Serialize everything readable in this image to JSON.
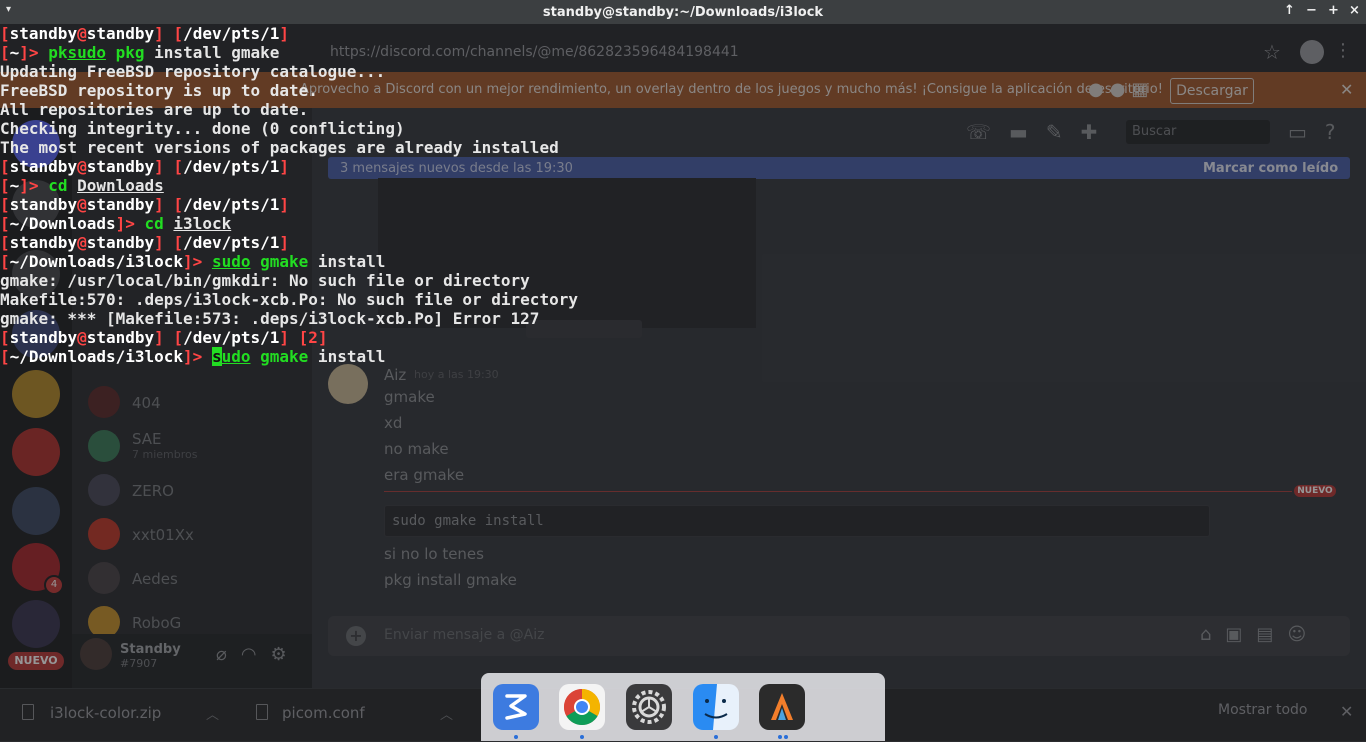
{
  "window": {
    "title": "standby@standby:~/Downloads/i3lock",
    "menu_icon": "▾",
    "controls": [
      "↑",
      "−",
      "+",
      "×"
    ]
  },
  "terminal": {
    "lines": [
      [
        {
          "t": "[",
          "c": "red"
        },
        {
          "t": "standby",
          "c": "white"
        },
        {
          "t": "@",
          "c": "red"
        },
        {
          "t": "standby",
          "c": "white"
        },
        {
          "t": "] [",
          "c": "red"
        },
        {
          "t": "/dev/pts/1",
          "c": "white"
        },
        {
          "t": "]",
          "c": "red"
        }
      ],
      [
        {
          "t": "[",
          "c": "red"
        },
        {
          "t": "~",
          "c": "white"
        },
        {
          "t": "]> ",
          "c": "red"
        },
        {
          "t": "pk",
          "c": "green"
        },
        {
          "t": "sudo",
          "c": "green ul"
        },
        {
          "t": " ",
          "c": ""
        },
        {
          "t": "pkg",
          "c": "green"
        },
        {
          "t": " install gmake",
          "c": ""
        }
      ],
      [
        {
          "t": "Updating FreeBSD repository catalogue...",
          "c": ""
        }
      ],
      [
        {
          "t": "FreeBSD repository is up to date.",
          "c": ""
        }
      ],
      [
        {
          "t": "All repositories are up to date.",
          "c": ""
        }
      ],
      [
        {
          "t": "Checking integrity... done (0 conflicting)",
          "c": ""
        }
      ],
      [
        {
          "t": "The most recent versions of packages are already installed",
          "c": ""
        }
      ],
      [
        {
          "t": "[",
          "c": "red"
        },
        {
          "t": "standby",
          "c": "white"
        },
        {
          "t": "@",
          "c": "red"
        },
        {
          "t": "standby",
          "c": "white"
        },
        {
          "t": "] [",
          "c": "red"
        },
        {
          "t": "/dev/pts/1",
          "c": "white"
        },
        {
          "t": "]",
          "c": "red"
        }
      ],
      [
        {
          "t": "[",
          "c": "red"
        },
        {
          "t": "~",
          "c": "white"
        },
        {
          "t": "]> ",
          "c": "red"
        },
        {
          "t": "cd",
          "c": "green"
        },
        {
          "t": " ",
          "c": ""
        },
        {
          "t": "Downloads",
          "c": "ul"
        }
      ],
      [
        {
          "t": "[",
          "c": "red"
        },
        {
          "t": "standby",
          "c": "white"
        },
        {
          "t": "@",
          "c": "red"
        },
        {
          "t": "standby",
          "c": "white"
        },
        {
          "t": "] [",
          "c": "red"
        },
        {
          "t": "/dev/pts/1",
          "c": "white"
        },
        {
          "t": "]",
          "c": "red"
        }
      ],
      [
        {
          "t": "[",
          "c": "red"
        },
        {
          "t": "~/Downloads",
          "c": "white"
        },
        {
          "t": "]> ",
          "c": "red"
        },
        {
          "t": "cd",
          "c": "green"
        },
        {
          "t": " ",
          "c": ""
        },
        {
          "t": "i3lock",
          "c": "ul"
        }
      ],
      [
        {
          "t": "[",
          "c": "red"
        },
        {
          "t": "standby",
          "c": "white"
        },
        {
          "t": "@",
          "c": "red"
        },
        {
          "t": "standby",
          "c": "white"
        },
        {
          "t": "] [",
          "c": "red"
        },
        {
          "t": "/dev/pts/1",
          "c": "white"
        },
        {
          "t": "]",
          "c": "red"
        }
      ],
      [
        {
          "t": "[",
          "c": "red"
        },
        {
          "t": "~/Downloads/i3lock",
          "c": "white"
        },
        {
          "t": "]> ",
          "c": "red"
        },
        {
          "t": "sudo",
          "c": "green ul"
        },
        {
          "t": " ",
          "c": ""
        },
        {
          "t": "gmake",
          "c": "green"
        },
        {
          "t": " install",
          "c": ""
        }
      ],
      [
        {
          "t": "gmake: /usr/local/bin/gmkdir: No such file or directory",
          "c": ""
        }
      ],
      [
        {
          "t": "Makefile:570: .deps/i3lock-xcb.Po: No such file or directory",
          "c": ""
        }
      ],
      [
        {
          "t": "gmake: *** [Makefile:573: .deps/i3lock-xcb.Po] Error 127",
          "c": ""
        }
      ],
      [
        {
          "t": "[",
          "c": "red"
        },
        {
          "t": "standby",
          "c": "white"
        },
        {
          "t": "@",
          "c": "red"
        },
        {
          "t": "standby",
          "c": "white"
        },
        {
          "t": "] [",
          "c": "red"
        },
        {
          "t": "/dev/pts/1",
          "c": "white"
        },
        {
          "t": "] [",
          "c": "red"
        },
        {
          "t": "2",
          "c": "red"
        },
        {
          "t": "]",
          "c": "red"
        }
      ],
      [
        {
          "t": "[",
          "c": "red"
        },
        {
          "t": "~/Downloads/i3lock",
          "c": "white"
        },
        {
          "t": "]> ",
          "c": "red"
        },
        {
          "t": "s",
          "c": "cursor"
        },
        {
          "t": "udo",
          "c": "green ul"
        },
        {
          "t": " ",
          "c": ""
        },
        {
          "t": "gmake",
          "c": "green"
        },
        {
          "t": " install",
          "c": ""
        }
      ]
    ]
  },
  "background": {
    "url": "https://discord.com/channels/@me/862823596484198441",
    "notice": "Aprovecho a Discord con un mejor rendimiento, un overlay dentro de los juegos y mucho más! ¡Consigue la aplicación de escritorio!",
    "notice_button": "Descargar",
    "search_placeholder": "Buscar",
    "new_messages": "3 mensajes nuevos desde las 19:30",
    "mark_read": "Marcar como leído",
    "dms": [
      {
        "name": "404",
        "sub": ""
      },
      {
        "name": "SAE",
        "sub": "7 miembros"
      },
      {
        "name": "ZERO",
        "sub": ""
      },
      {
        "name": "xxt01Xx",
        "sub": ""
      },
      {
        "name": "Aedes",
        "sub": ""
      },
      {
        "name": "RoboG",
        "sub": ""
      }
    ],
    "user": {
      "name": "Standby",
      "tag": "#7907"
    },
    "new_badge": "NUEVO",
    "server_badge": "4",
    "message": {
      "author": "Aiz",
      "time": "hoy a las 19:30",
      "lines": [
        "gmake",
        "xd",
        "no make",
        "era gmake"
      ],
      "divider_label": "NUEVO",
      "code": "sudo gmake install",
      "after": [
        "si no lo tenes",
        "pkg install gmake"
      ]
    },
    "input_placeholder": "Enviar mensaje a @Aiz",
    "downloads": [
      {
        "name": "i3lock-color.zip"
      },
      {
        "name": "picom.conf"
      }
    ],
    "show_all": "Mostrar todo"
  },
  "dock": {
    "apps": [
      {
        "name": "Emacs",
        "color": "#3d7be0"
      },
      {
        "name": "Google Chrome",
        "color": "#ffffff"
      },
      {
        "name": "System Preferences",
        "color": "#3a3a3c"
      },
      {
        "name": "Finder",
        "color": "#4aa6f0"
      },
      {
        "name": "Alacritty",
        "color": "#2b2b2b"
      }
    ]
  }
}
